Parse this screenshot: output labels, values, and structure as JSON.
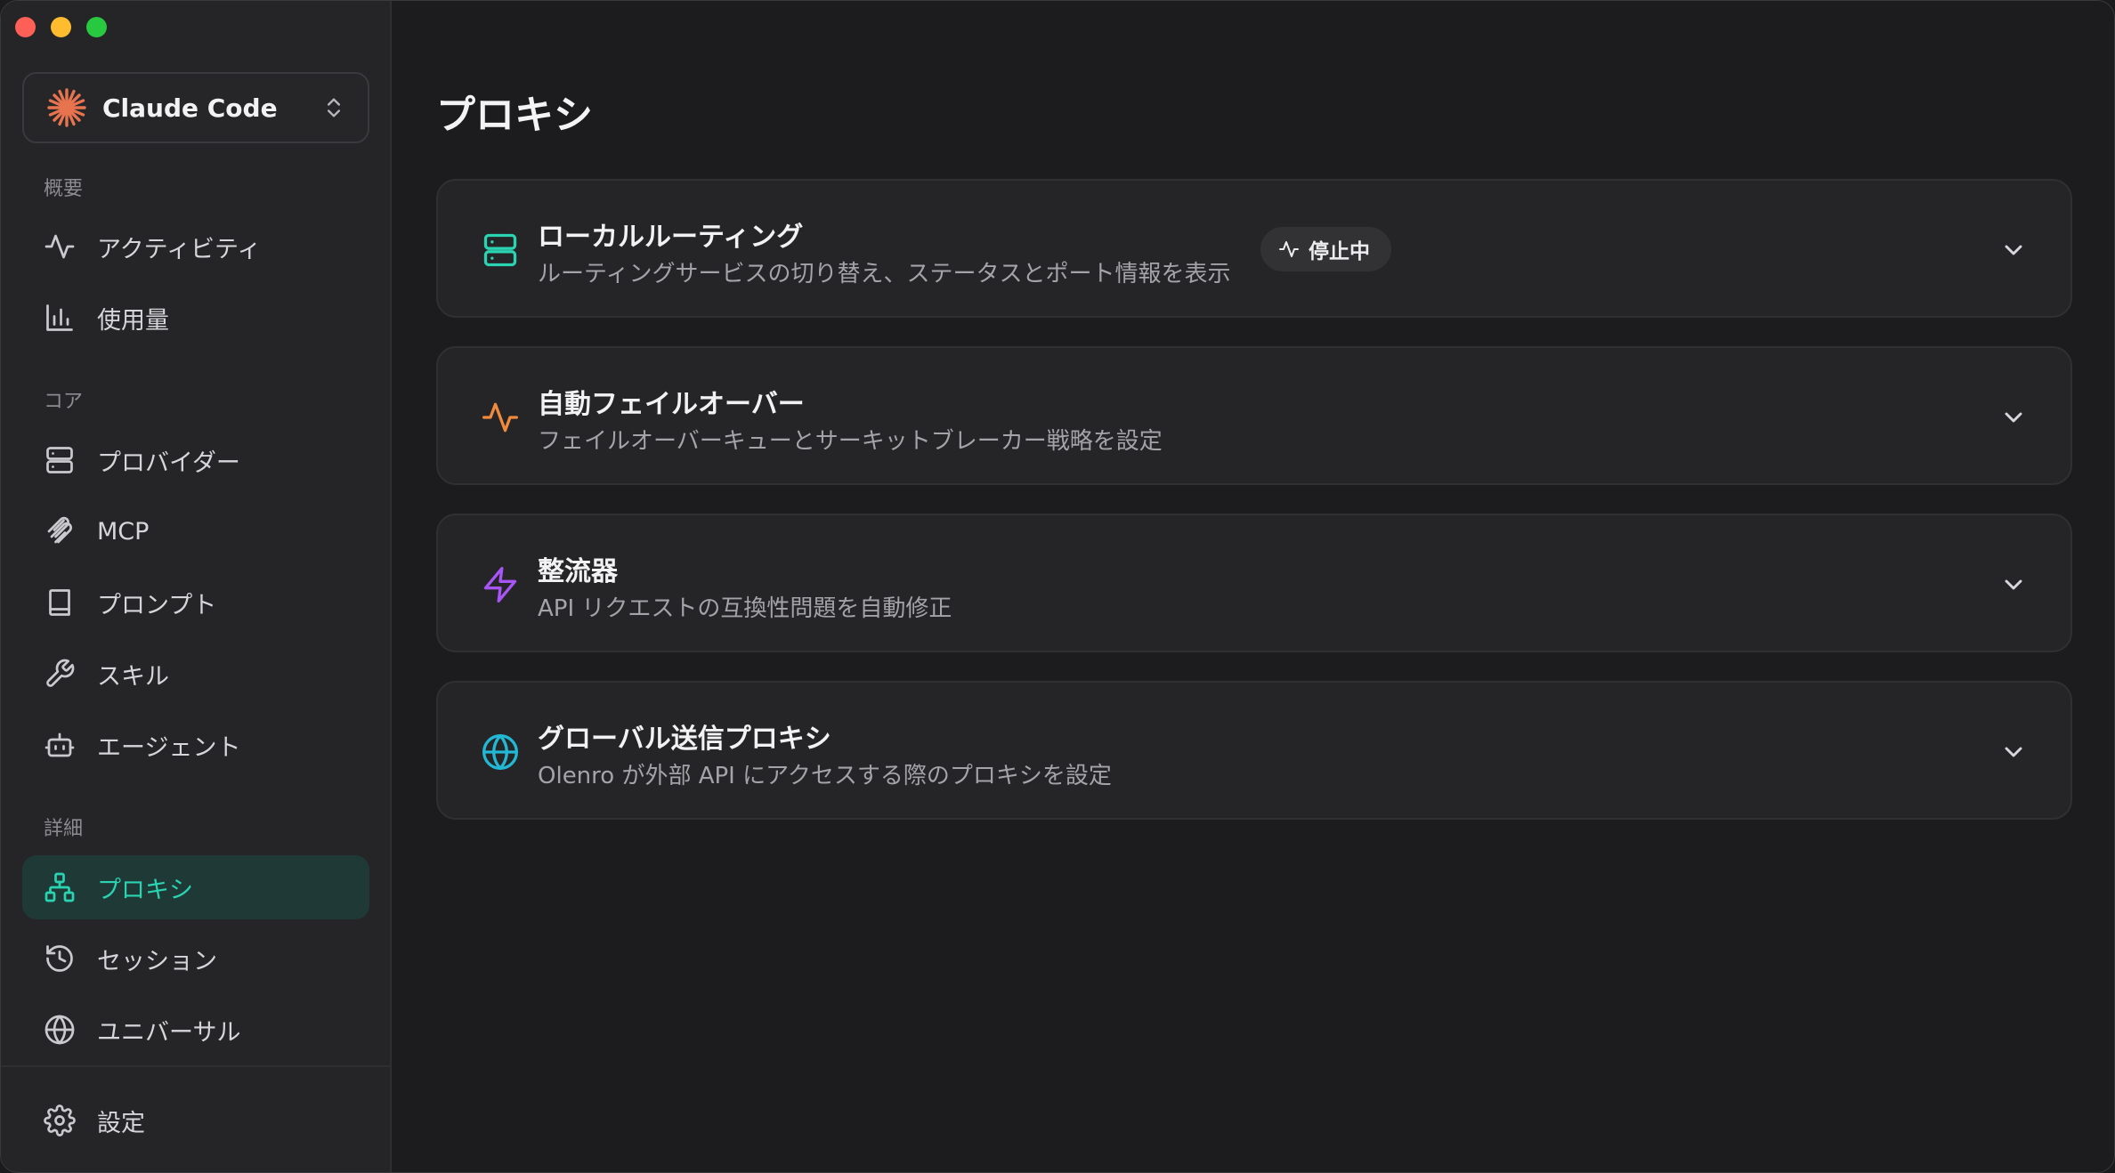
{
  "app": {
    "name": "Claude Code",
    "accent_color": "#2ad4b2",
    "logo_color": "#e8734f"
  },
  "sidebar": {
    "sections": {
      "overview": "概要",
      "core": "コア",
      "details": "詳細"
    },
    "items": {
      "activity": {
        "label": "アクティビティ",
        "icon": "activity-icon"
      },
      "usage": {
        "label": "使用量",
        "icon": "bar-chart-icon"
      },
      "providers": {
        "label": "プロバイダー",
        "icon": "server-icon"
      },
      "mcp": {
        "label": "MCP",
        "icon": "mcp-icon"
      },
      "prompts": {
        "label": "プロンプト",
        "icon": "book-icon"
      },
      "skills": {
        "label": "スキル",
        "icon": "wrench-icon"
      },
      "agents": {
        "label": "エージェント",
        "icon": "bot-icon"
      },
      "proxy": {
        "label": "プロキシ",
        "icon": "network-icon",
        "active": true
      },
      "sessions": {
        "label": "セッション",
        "icon": "history-icon"
      },
      "universal": {
        "label": "ユニバーサル",
        "icon": "globe-icon"
      },
      "settings": {
        "label": "設定",
        "icon": "gear-icon"
      }
    }
  },
  "main": {
    "title": "プロキシ",
    "cards": [
      {
        "title": "ローカルルーティング",
        "subtitle": "ルーティングサービスの切り替え、ステータスとポート情報を表示",
        "icon": "server-icon",
        "icon_color": "#2ad4b2",
        "badge": "停止中"
      },
      {
        "title": "自動フェイルオーバー",
        "subtitle": "フェイルオーバーキューとサーキットブレーカー戦略を設定",
        "icon": "activity-icon",
        "icon_color": "#f08a3c"
      },
      {
        "title": "整流器",
        "subtitle": "API リクエストの互換性問題を自動修正",
        "icon": "zap-icon",
        "icon_color": "#a855f7"
      },
      {
        "title": "グローバル送信プロキシ",
        "subtitle": "Olenro が外部 API にアクセスする際のプロキシを設定",
        "icon": "globe-icon",
        "icon_color": "#22b8d4"
      }
    ]
  }
}
